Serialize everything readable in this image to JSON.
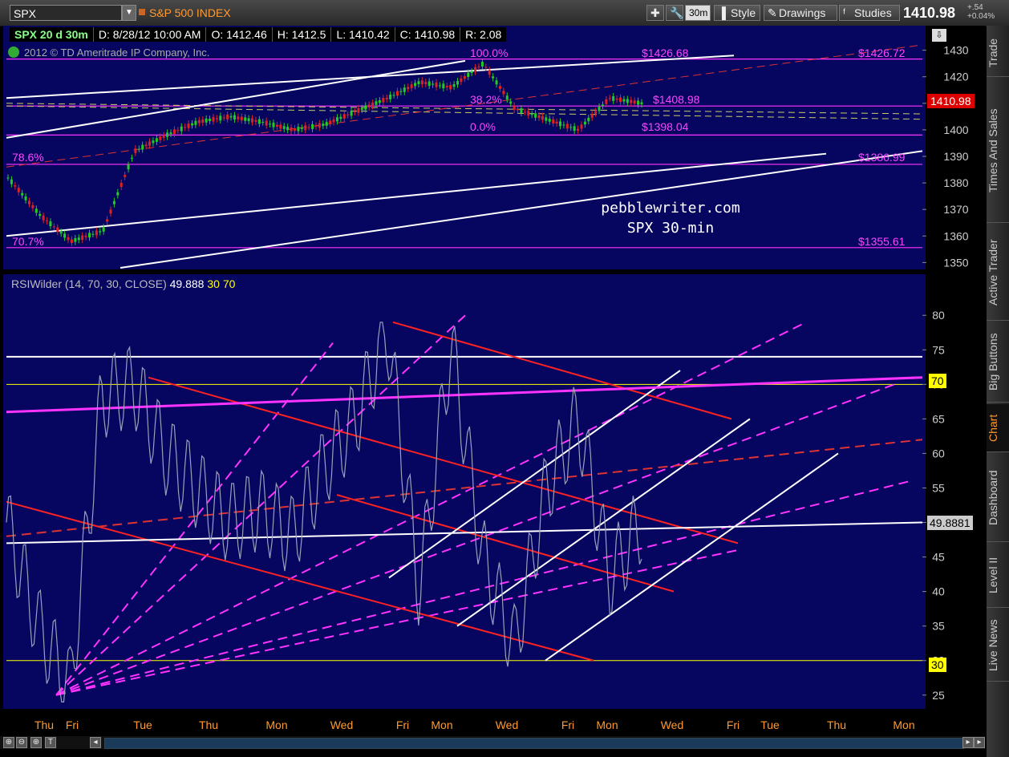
{
  "toolbar": {
    "symbol": "SPX",
    "symbol_name": "S&P 500 INDEX",
    "interval_button": "30m",
    "style_label": "Style",
    "drawings_label": "Drawings",
    "studies_label": "Studies",
    "last_price": "1410.98",
    "net_change": "+.54",
    "pct_change": "+0.04%"
  },
  "info_bar": {
    "title": "SPX 20 d 30m",
    "date": "D: 8/28/12 10:00 AM",
    "open": "O: 1412.46",
    "high": "H: 1412.5",
    "low": "L: 1410.42",
    "close": "C: 1410.98",
    "range": "R: 2.08"
  },
  "copyright": "2012 © TD Ameritrade IP Company, Inc.",
  "watermark": {
    "line1": "pebblewriter.com",
    "line2": "SPX 30-min"
  },
  "price_labels": {
    "p1426_68": "$1426.68",
    "p1426_72": "$1426.72",
    "p1408_98": "$1408.98",
    "p1398_04": "$1398.04",
    "p1386_99": "$1386.99",
    "p1355_61": "$1355.61",
    "fib100": "100.0%",
    "fib382": "38.2%",
    "fib0": "0.0%",
    "fib786": "78.6%",
    "fib707": "70.7%",
    "close_tag": "1410.98"
  },
  "rsi": {
    "title": "RSIWilder (14, 70, 30, CLOSE)",
    "value": "49.888",
    "ob": "30",
    "os": "70",
    "current_tag": "49.8881",
    "tag70": "70",
    "tag30": "30"
  },
  "right_tabs": [
    "Trade",
    "Times And Sales",
    "Active Trader",
    "Big Buttons",
    "Chart",
    "Dashboard",
    "Level II",
    "Live News"
  ],
  "colors": {
    "background": "#060660",
    "up": "#22cc22",
    "down": "#dd2222",
    "fib": "#ff33ff",
    "rsi_line": "#9aa0b8",
    "accent": "#ff9a2e"
  },
  "chart_data": [
    {
      "type": "line",
      "title": "SPX 20 d 30m",
      "series": [
        {
          "name": "SPX",
          "x": [
            0,
            1,
            2,
            3,
            4,
            5,
            6,
            7,
            8,
            9,
            10,
            11,
            12,
            13,
            14,
            15,
            16,
            17,
            18,
            19,
            20
          ],
          "values": [
            1382,
            1368,
            1358,
            1362,
            1392,
            1398,
            1403,
            1405,
            1403,
            1400,
            1402,
            1407,
            1412,
            1418,
            1416,
            1425,
            1408,
            1404,
            1400,
            1412,
            1410
          ]
        }
      ],
      "xlabels": [
        "Thu",
        "Fri",
        "Tue",
        "Thu",
        "Mon",
        "Wed",
        "Fri",
        "Mon",
        "Wed",
        "Fri",
        "Mon",
        "Wed",
        "Fri",
        "Tue",
        "Thu",
        "Mon"
      ],
      "yticks": [
        1350,
        1360,
        1370,
        1380,
        1390,
        1400,
        1410,
        1420,
        1430
      ],
      "ylim": [
        1348,
        1432
      ]
    },
    {
      "type": "line",
      "title": "RSIWilder (14, 70, 30, CLOSE)",
      "series": [
        {
          "name": "RSIWilder",
          "x": [
            0,
            1,
            2,
            3,
            4,
            5,
            6,
            7,
            8,
            9,
            10,
            11,
            12,
            13,
            14,
            15,
            16,
            17,
            18,
            19,
            20
          ],
          "values": [
            50,
            35,
            26,
            68,
            70,
            60,
            55,
            50,
            52,
            48,
            58,
            65,
            78,
            40,
            76,
            45,
            32,
            55,
            65,
            42,
            50
          ]
        }
      ],
      "yticks": [
        25,
        30,
        35,
        40,
        45,
        50,
        55,
        60,
        65,
        70,
        75,
        80
      ],
      "ylim": [
        23,
        82
      ]
    }
  ]
}
